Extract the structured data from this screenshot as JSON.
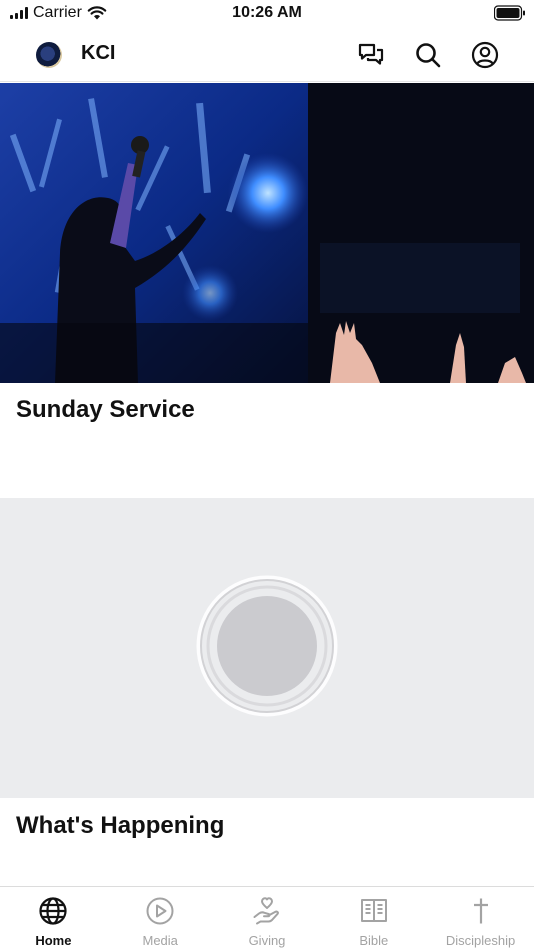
{
  "status_bar": {
    "carrier": "Carrier",
    "time": "10:26 AM"
  },
  "header": {
    "title": "KCI",
    "icons": [
      "chat-icon",
      "search-icon",
      "profile-icon"
    ]
  },
  "cards": [
    {
      "title": "Sunday Service"
    },
    {
      "title": "What's Happening"
    }
  ],
  "tabbar": {
    "active": "Home",
    "tabs": [
      {
        "label": "Home",
        "icon": "globe-icon"
      },
      {
        "label": "Media",
        "icon": "play-icon"
      },
      {
        "label": "Giving",
        "icon": "giving-icon"
      },
      {
        "label": "Bible",
        "icon": "book-icon"
      },
      {
        "label": "Discipleship",
        "icon": "cross-icon"
      }
    ]
  },
  "colors": {
    "accent": "#111111",
    "inactive": "#a3a3a3",
    "placeholder_bg": "#ebecee"
  }
}
